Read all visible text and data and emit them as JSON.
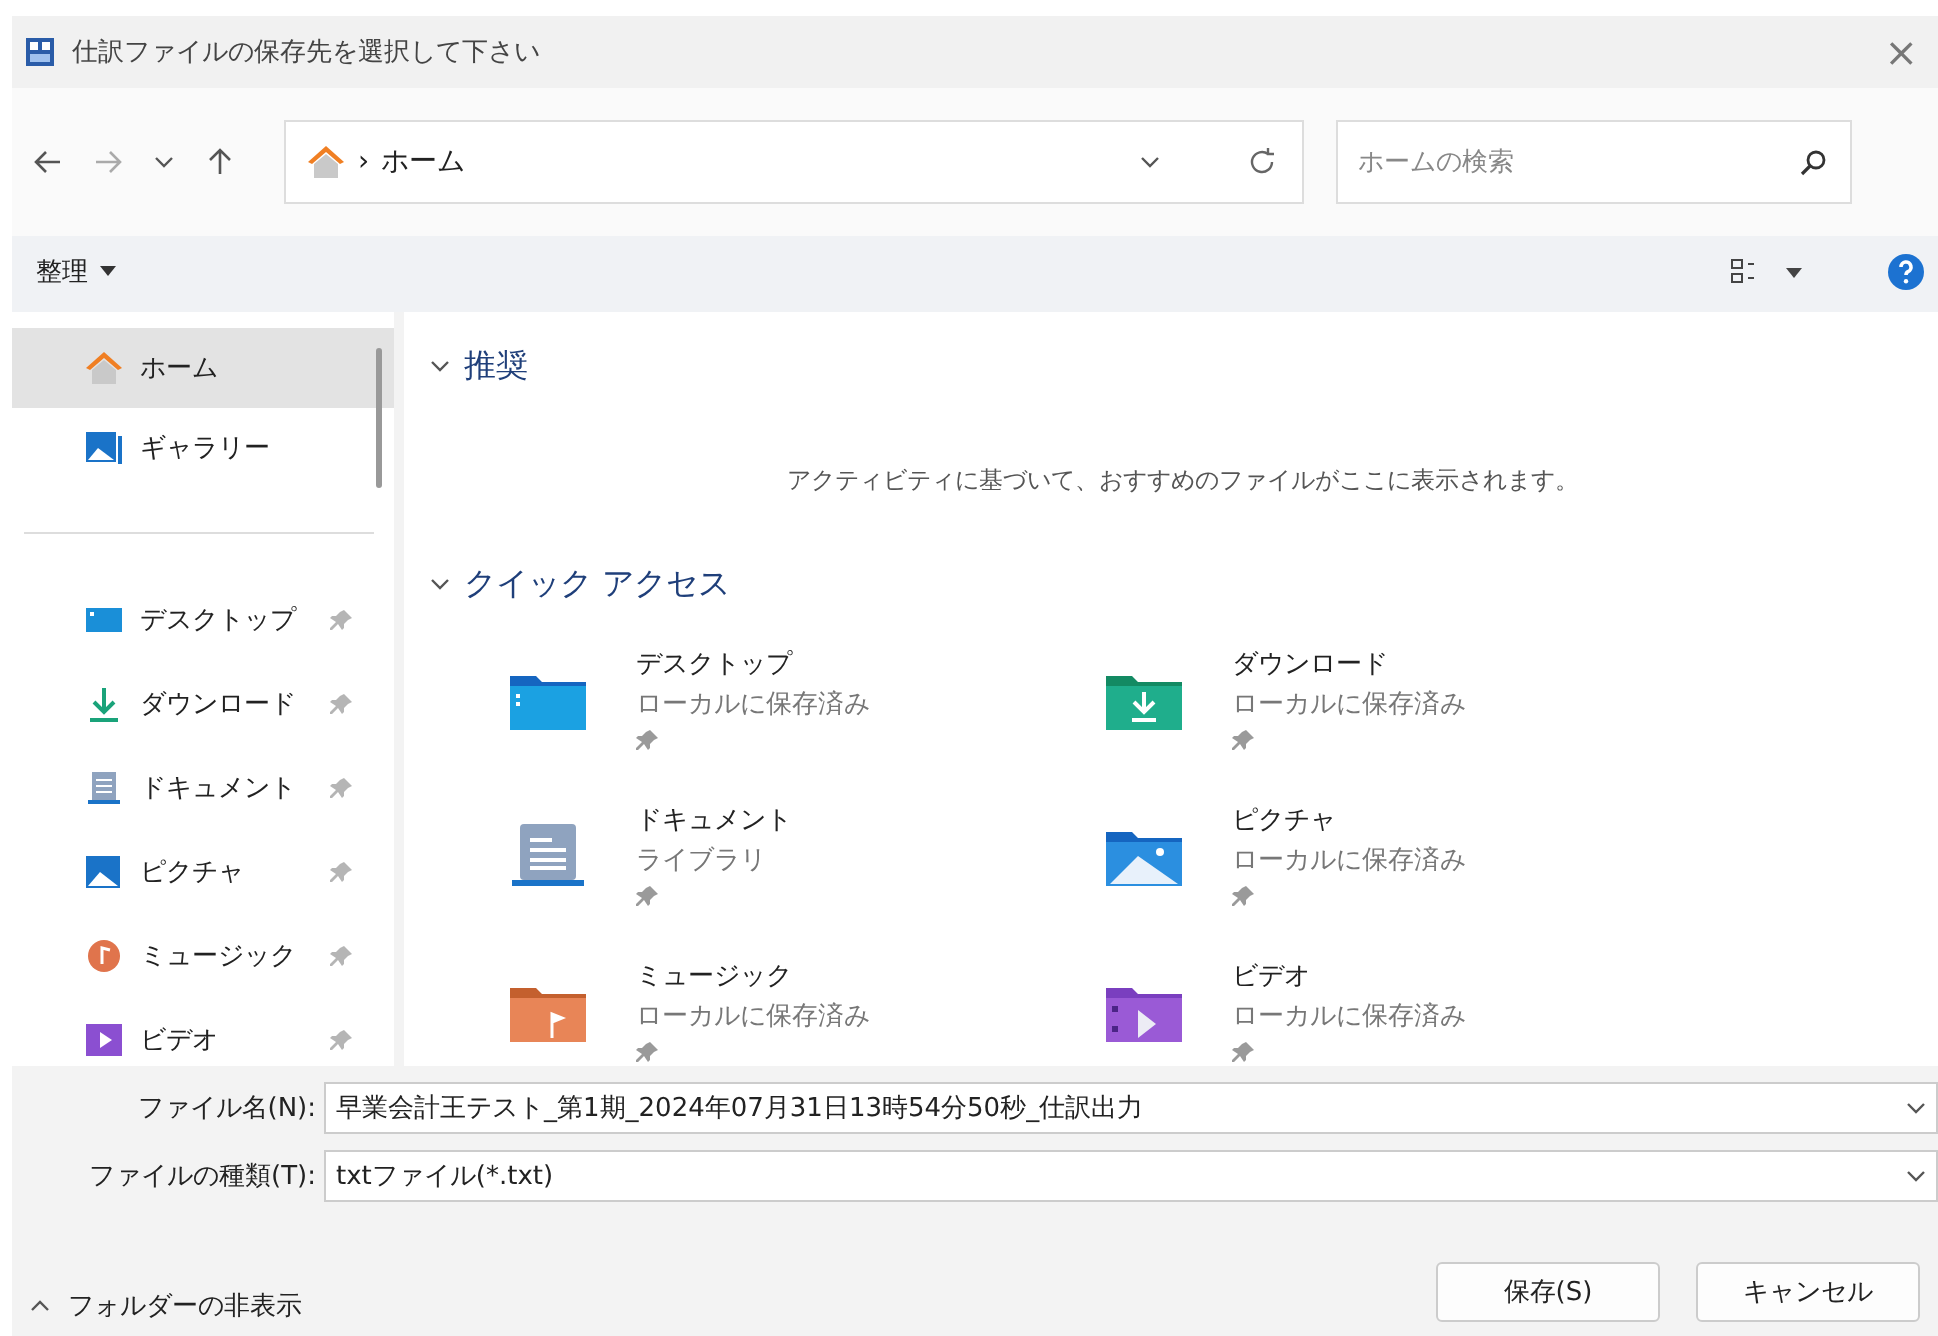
{
  "window": {
    "title": "仕訳ファイルの保存先を選択して下さい",
    "close": "×"
  },
  "nav": {
    "address": "ホーム",
    "separator": "›",
    "search": {
      "placeholder": "ホームの検索"
    }
  },
  "toolbar": {
    "organize": "整理"
  },
  "sidebar": {
    "items": [
      {
        "label": "ホーム",
        "kind": "home",
        "selected": true,
        "pinned": false
      },
      {
        "label": "ギャラリー",
        "kind": "gallery",
        "selected": false,
        "pinned": false
      }
    ],
    "pinned_items": [
      {
        "label": "デスクトップ",
        "kind": "desktop",
        "selected": false,
        "pinned": true
      },
      {
        "label": "ダウンロード",
        "kind": "download",
        "selected": false,
        "pinned": true
      },
      {
        "label": "ドキュメント",
        "kind": "documents",
        "selected": false,
        "pinned": true
      },
      {
        "label": "ピクチャ",
        "kind": "pictures",
        "selected": false,
        "pinned": true
      },
      {
        "label": "ミュージック",
        "kind": "music",
        "selected": false,
        "pinned": true
      },
      {
        "label": "ビデオ",
        "kind": "videos",
        "selected": false,
        "pinned": true
      }
    ]
  },
  "sections": [
    {
      "title": "推奨",
      "expanded": true,
      "message": "アクティビティに基づいて、おすすめのファイルがここに表示されます。"
    },
    {
      "title": "クイック アクセス",
      "expanded": true,
      "items": [
        {
          "name": "デスクトップ",
          "detail": "ローカルに保存済み",
          "kind": "desktop",
          "pinned": true
        },
        {
          "name": "ダウンロード",
          "detail": "ローカルに保存済み",
          "kind": "download",
          "pinned": true
        },
        {
          "name": "ドキュメント",
          "detail": "ライブラリ",
          "kind": "documents",
          "pinned": true
        },
        {
          "name": "ピクチャ",
          "detail": "ローカルに保存済み",
          "kind": "pictures",
          "pinned": true
        },
        {
          "name": "ミュージック",
          "detail": "ローカルに保存済み",
          "kind": "music",
          "pinned": true
        },
        {
          "name": "ビデオ",
          "detail": "ローカルに保存済み",
          "kind": "videos",
          "pinned": true
        }
      ]
    }
  ],
  "fields": [
    {
      "label": "ファイル名(N):",
      "value": "早業会計王テスト_第1期_2024年07月31日13時54分50秒_仕訳出力"
    },
    {
      "label": "ファイルの種類(T):",
      "value": "txtファイル(*.txt)"
    }
  ],
  "footer": {
    "toggle": "フォルダーの非表示",
    "buttons": [
      "保存(S)",
      "キャンセル"
    ]
  }
}
